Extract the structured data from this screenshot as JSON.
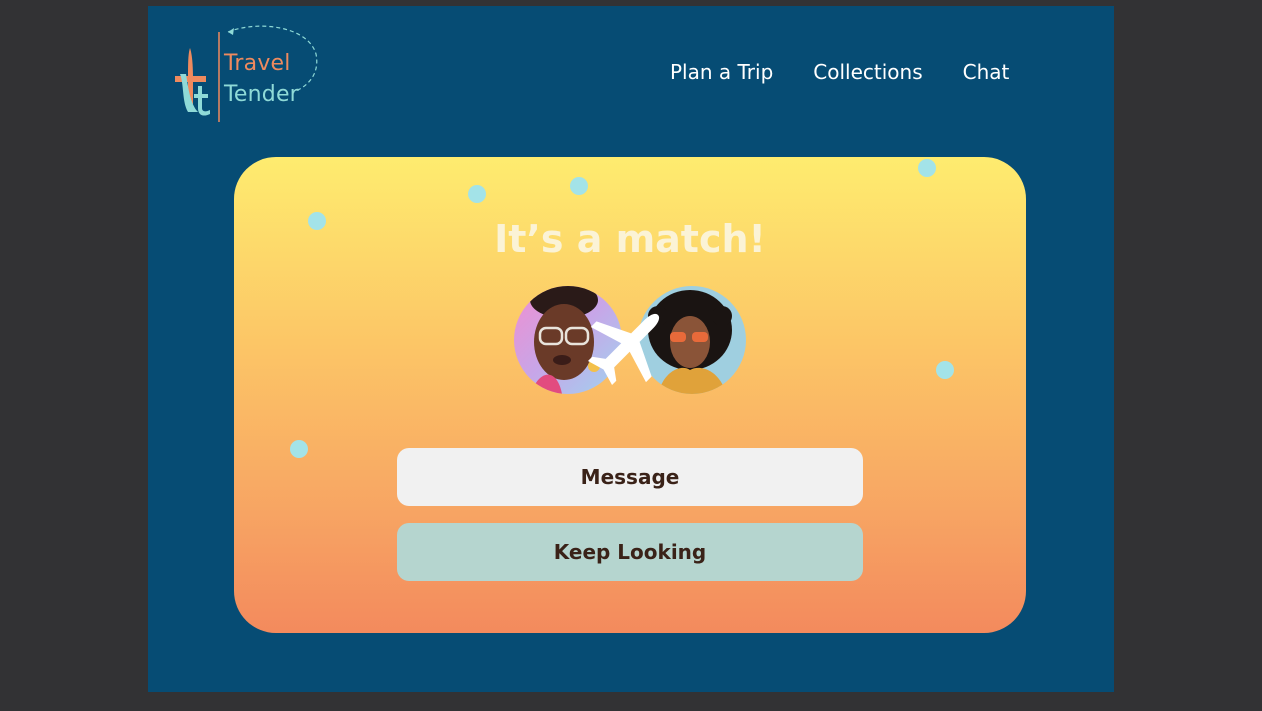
{
  "logo": {
    "word_1": "Travel",
    "word_2": "Tender",
    "icon": "airplane-tt-logo"
  },
  "nav": {
    "items": [
      "Plan a Trip",
      "Collections",
      "Chat"
    ]
  },
  "match": {
    "title": "It’s a match!",
    "avatars": [
      "avatar-woman-glasses-pink",
      "avatar-woman-curly-hair-sunglasses"
    ],
    "center_icon": "airplane-icon"
  },
  "buttons": {
    "message": "Message",
    "keep_looking": "Keep Looking"
  },
  "colors": {
    "background": "#064c74",
    "outer": "#323234",
    "card_top": "#feec6f",
    "card_bottom": "#f38a5d",
    "accent_orange": "#ee8a5e",
    "accent_teal": "#8fdad7",
    "dots": "#a3e3e8",
    "message_button": "#f1f1f1",
    "keep_looking_button": "#b5d5cf"
  }
}
